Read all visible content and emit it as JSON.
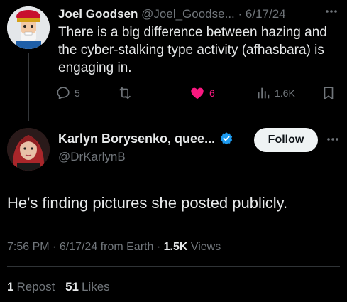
{
  "reply_tweet": {
    "author_name": "Joel Goodsen",
    "author_handle": "@Joel_Goodse...",
    "separator": "·",
    "date": "6/17/24",
    "text": "There is a big difference between hazing and the cyber-stalking type activity (afhasbara) is engaging in.",
    "actions": {
      "replies": "5",
      "retweets": "",
      "likes": "6",
      "views": "1.6K"
    },
    "like_color": "#f91880"
  },
  "main_tweet": {
    "author_name": "Karlyn Borysenko, quee...",
    "author_handle": "@DrKarlynB",
    "verified_color": "#1d9bf0",
    "follow_label": "Follow",
    "text": "He's finding pictures she posted publicly.",
    "time": "7:56 PM",
    "date": "6/17/24",
    "source": "from Earth",
    "views_count": "1.5K",
    "views_label": "Views",
    "reposts_count": "1",
    "reposts_label": "Repost",
    "likes_count": "51",
    "likes_label": "Likes"
  },
  "icons": {
    "reply": "comment-icon",
    "retweet": "retweet-icon",
    "like": "heart-icon",
    "views": "bar-chart-icon",
    "bookmark": "bookmark-icon",
    "more": "more-dots-icon",
    "verified": "verified-badge-icon"
  }
}
